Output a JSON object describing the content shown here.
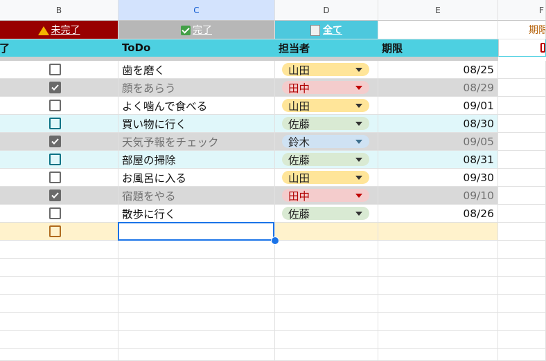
{
  "columns": [
    "B",
    "C",
    "D",
    "E",
    "F"
  ],
  "filters": {
    "incomplete": "未完了",
    "complete": "完了",
    "all": "全て",
    "deadline": "期限"
  },
  "headers": {
    "status": "了",
    "todo": "ToDo",
    "assignee": "担当者",
    "due": "期限"
  },
  "rows": [
    {
      "todo": "歯を磨く",
      "assignee": "山田",
      "due": "08/25",
      "done": false
    },
    {
      "todo": "顔をあらう",
      "assignee": "田中",
      "due": "08/29",
      "done": true
    },
    {
      "todo": "よく噛んで食べる",
      "assignee": "山田",
      "due": "09/01",
      "done": false
    },
    {
      "todo": "買い物に行く",
      "assignee": "佐藤",
      "due": "08/30",
      "done": false
    },
    {
      "todo": "天気予報をチェック",
      "assignee": "鈴木",
      "due": "09/05",
      "done": true
    },
    {
      "todo": "部屋の掃除",
      "assignee": "佐藤",
      "due": "08/31",
      "done": false
    },
    {
      "todo": "お風呂に入る",
      "assignee": "山田",
      "due": "09/30",
      "done": false
    },
    {
      "todo": "宿題をやる",
      "assignee": "田中",
      "due": "09/10",
      "done": true
    },
    {
      "todo": "散歩に行く",
      "assignee": "佐藤",
      "due": "08/26",
      "done": false
    }
  ],
  "colors": {
    "header": "#4dd0e1",
    "incomplete_button": "#980000",
    "selection": "#1a73e8"
  }
}
